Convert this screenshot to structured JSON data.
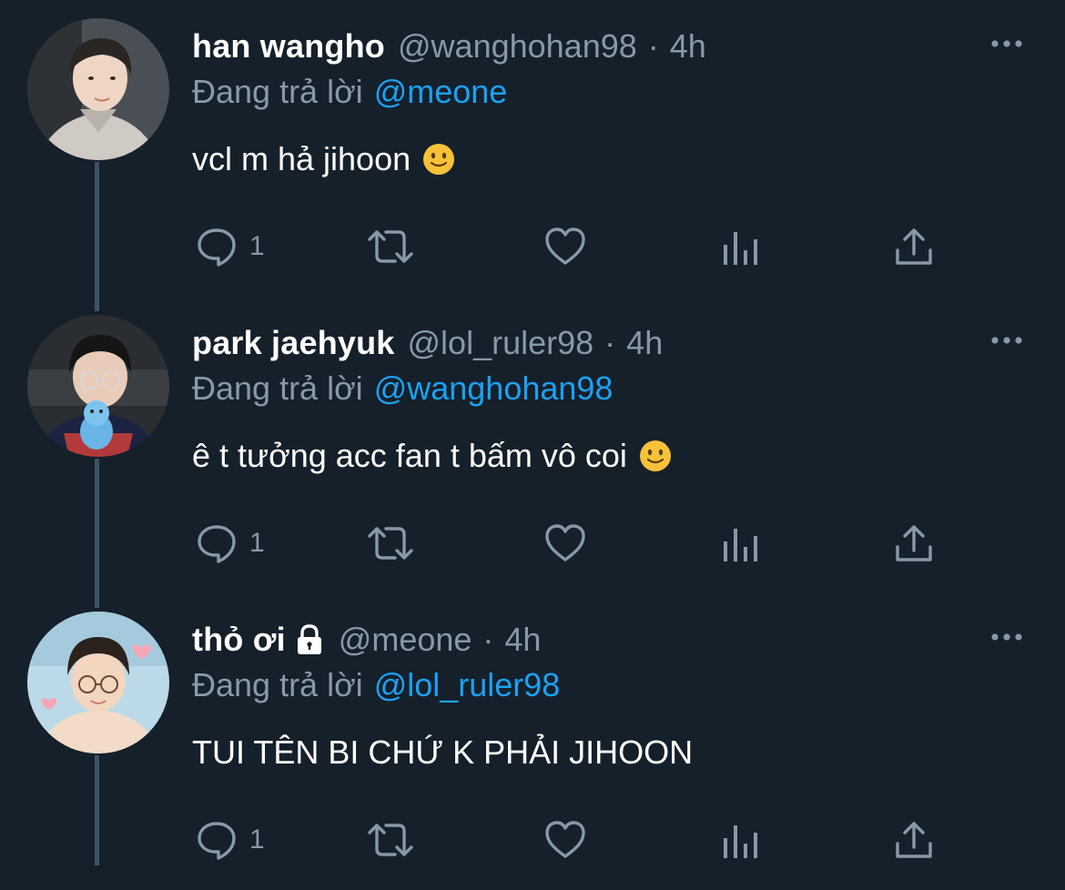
{
  "colors": {
    "background": "#15202b",
    "secondary_text": "#8899a6",
    "mention": "#1da1f2",
    "thread_line": "#3d5466"
  },
  "tweets": [
    {
      "display_name": "han wangho",
      "locked": false,
      "handle": "@wanghohan98",
      "separator": "·",
      "time": "4h",
      "reply_prefix": "Đang trả lời",
      "reply_to": "@meone",
      "text": "vcl m hả jihoon",
      "emoji": "slightly-smiling-face",
      "reply_count": "1",
      "avatar": "avatar-photo"
    },
    {
      "display_name": "park jaehyuk",
      "locked": false,
      "handle": "@lol_ruler98",
      "separator": "·",
      "time": "4h",
      "reply_prefix": "Đang trả lời",
      "reply_to": "@wanghohan98",
      "text": "ê t tưởng acc fan t bấm vô coi",
      "emoji": "slightly-smiling-face",
      "reply_count": "1",
      "avatar": "avatar-photo"
    },
    {
      "display_name": "thỏ ơi",
      "locked": true,
      "handle": "@meone",
      "separator": "·",
      "time": "4h",
      "reply_prefix": "Đang trả lời",
      "reply_to": "@lol_ruler98",
      "text": "TUI TÊN BI CHỨ K PHẢI JIHOON",
      "emoji": "",
      "reply_count": "1",
      "avatar": "avatar-photo"
    }
  ]
}
